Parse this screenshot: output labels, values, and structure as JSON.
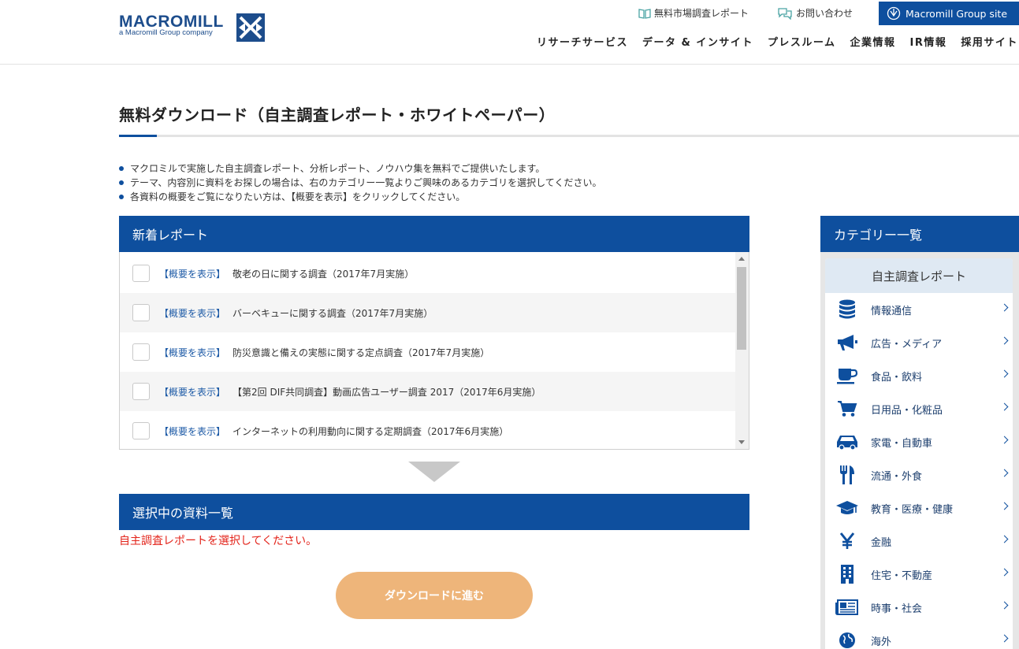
{
  "header": {
    "logo_text": "MACROMILL",
    "logo_sub": "a Macromill Group company",
    "top_links": {
      "report": "無料市場調査レポート",
      "contact": "お問い合わせ",
      "group_site": "Macromill Group site"
    },
    "nav": [
      "リサーチサービス",
      "データ & インサイト",
      "プレスルーム",
      "企業情報",
      "IR情報",
      "採用サイト"
    ]
  },
  "page": {
    "title": "無料ダウンロード（自主調査レポート・ホワイトペーパー）",
    "intro": [
      "マクロミルで実施した自主調査レポート、分析レポート、ノウハウ集を無料でご提供いたします。",
      "テーマ、内容別に資料をお探しの場合は、右のカテゴリー一覧よりご興味のあるカテゴリを選択してください。",
      "各資料の概要をご覧になりたい方は、【概要を表示】をクリックしてください。"
    ]
  },
  "new_reports": {
    "heading": "新着レポート",
    "summary_label": "【概要を表示】",
    "items": [
      {
        "title": "敬老の日に関する調査（2017年7月実施）"
      },
      {
        "title": "バーベキューに関する調査（2017年7月実施）"
      },
      {
        "title": "防災意識と備えの実態に関する定点調査（2017年7月実施）"
      },
      {
        "title": "【第2回 DIF共同調査】動画広告ユーザー調査 2017（2017年6月実施）"
      },
      {
        "title": "インターネットの利用動向に関する定期調査（2017年6月実施）"
      }
    ]
  },
  "selected": {
    "heading": "選択中の資料一覧",
    "error": "自主調査レポートを選択してください。",
    "download_label": "ダウンロードに進む"
  },
  "category": {
    "heading": "カテゴリー一覧",
    "subheading": "自主調査レポート",
    "items": [
      {
        "label": "情報通信",
        "icon": "database-icon"
      },
      {
        "label": "広告・メディア",
        "icon": "megaphone-icon"
      },
      {
        "label": "食品・飲料",
        "icon": "cup-icon"
      },
      {
        "label": "日用品・化粧品",
        "icon": "cart-icon"
      },
      {
        "label": "家電・自動車",
        "icon": "car-icon"
      },
      {
        "label": "流通・外食",
        "icon": "fork-knife-icon"
      },
      {
        "label": "教育・医療・健康",
        "icon": "graduation-cap-icon"
      },
      {
        "label": "金融",
        "icon": "yen-icon"
      },
      {
        "label": "住宅・不動産",
        "icon": "building-icon"
      },
      {
        "label": "時事・社会",
        "icon": "newspaper-icon"
      },
      {
        "label": "海外",
        "icon": "globe-icon"
      }
    ]
  },
  "colors": {
    "brand_blue": "#0e4f9e",
    "download_button": "#eeb57a",
    "error_red": "#e3241b",
    "link_blue": "#1d5aa6"
  }
}
